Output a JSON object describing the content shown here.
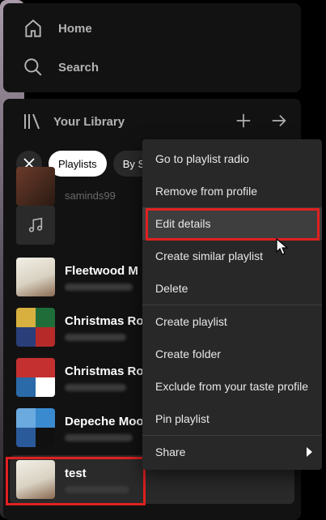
{
  "nav": {
    "home_label": "Home",
    "search_label": "Search"
  },
  "library": {
    "title": "Your Library",
    "filters": {
      "playlists": "Playlists",
      "by": "By S"
    },
    "partial_row_text": "saminds99",
    "items": [
      {
        "title": ""
      },
      {
        "title": "Fleetwood M"
      },
      {
        "title": "Christmas Ro"
      },
      {
        "title": "Christmas Ro"
      },
      {
        "title": "Depeche Moo"
      },
      {
        "title": "test"
      }
    ]
  },
  "context_menu": {
    "items": [
      "Go to playlist radio",
      "Remove from profile",
      "Edit details",
      "Create similar playlist",
      "Delete",
      "Create playlist",
      "Create folder",
      "Exclude from your taste profile",
      "Pin playlist",
      "Share"
    ]
  },
  "colors": {
    "highlight": "#e02020",
    "panel": "#121212",
    "menu": "#282828"
  },
  "icons": [
    "home-icon",
    "search-icon",
    "library-icon",
    "plus-icon",
    "arrow-right-icon",
    "close-icon",
    "music-note-icon",
    "chevron-right-icon",
    "cursor-icon"
  ]
}
